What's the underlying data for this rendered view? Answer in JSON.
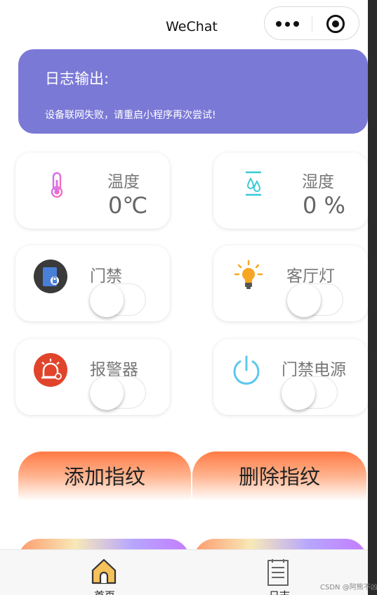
{
  "navbar": {
    "title": "WeChat"
  },
  "log": {
    "title": "日志输出:",
    "message": "设备联网失败，请重启小程序再次尝试!"
  },
  "sensors": {
    "temperature": {
      "label": "温度",
      "value": "0℃"
    },
    "humidity": {
      "label": "湿度",
      "value": "0 %"
    }
  },
  "switches": {
    "door": {
      "label": "门禁",
      "on": false
    },
    "light": {
      "label": "客厅灯",
      "on": false
    },
    "alarm": {
      "label": "报警器",
      "on": false
    },
    "door_power": {
      "label": "门禁电源",
      "on": false
    }
  },
  "buttons": {
    "add_fingerprint": "添加指纹",
    "delete_fingerprint": "删除指纹"
  },
  "tabbar": {
    "items": [
      {
        "label": "首页",
        "icon": "home-icon",
        "active": true
      },
      {
        "label": "日志",
        "icon": "document-icon",
        "active": false
      }
    ]
  },
  "watermark": "CSDN @阿熊不凶",
  "colors": {
    "log_card": "#7b79d6",
    "button_top": "#ff7a45",
    "home_icon": "#f5c15a"
  }
}
